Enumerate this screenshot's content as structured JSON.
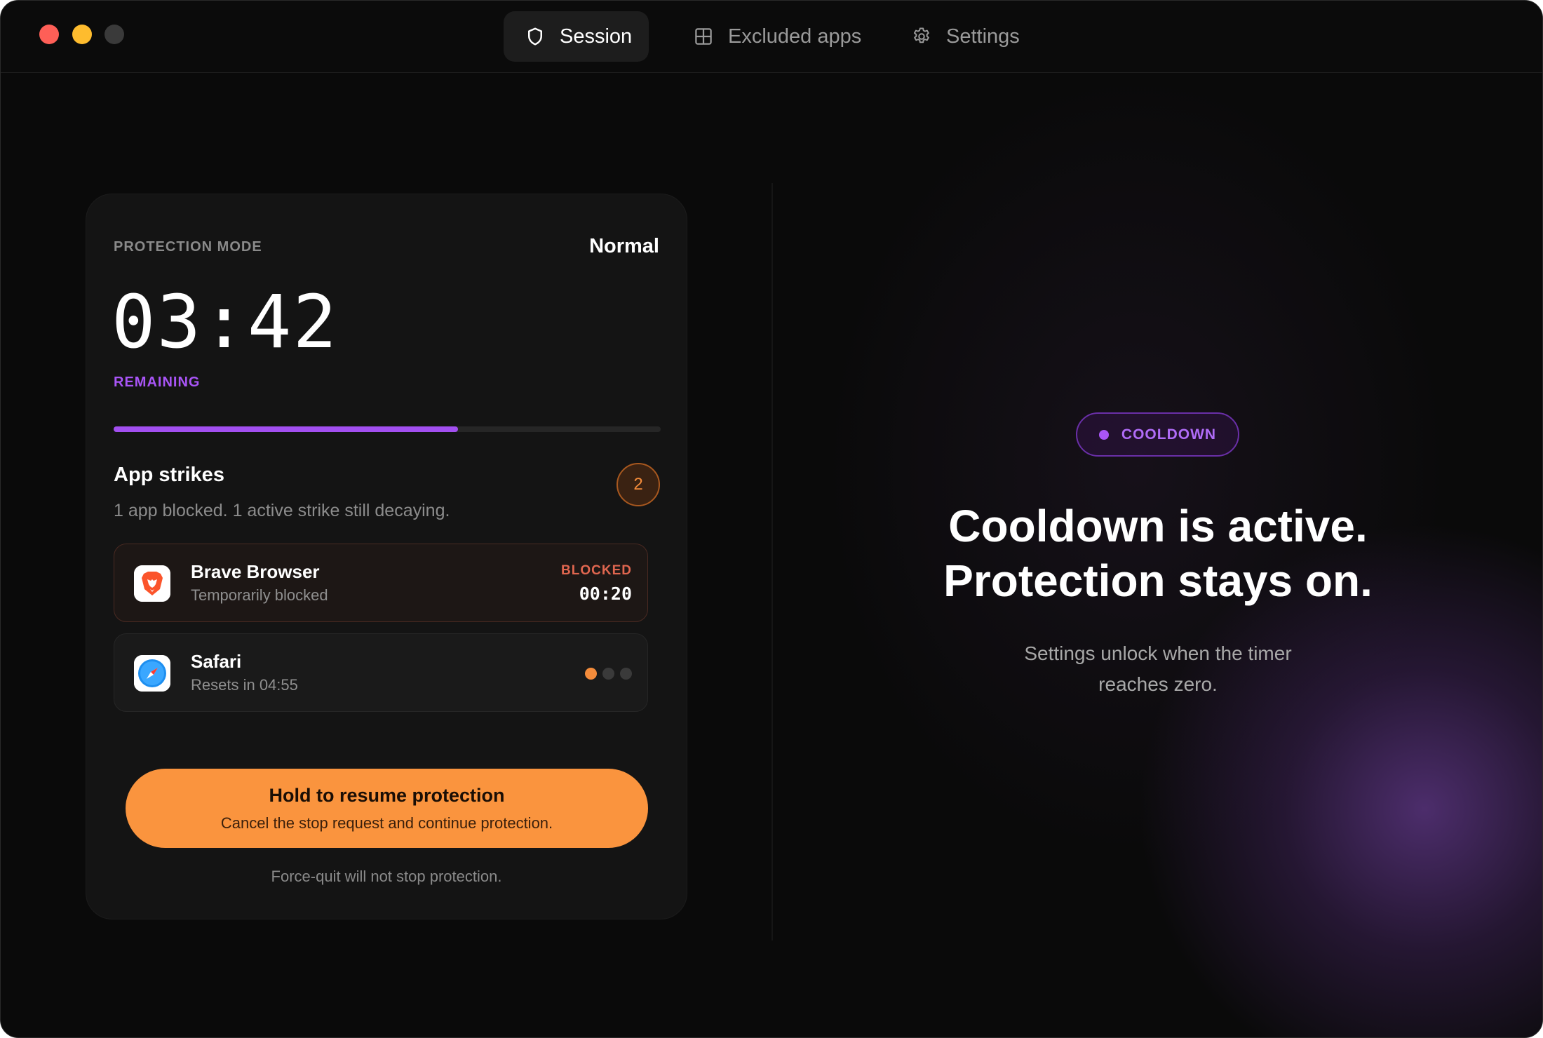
{
  "tabs": [
    {
      "label": "Session",
      "icon": "shield-icon",
      "active": true
    },
    {
      "label": "Excluded apps",
      "icon": "grid-icon",
      "active": false
    },
    {
      "label": "Settings",
      "icon": "gear-icon",
      "active": false
    }
  ],
  "session": {
    "mode_label": "PROTECTION MODE",
    "mode_value": "Normal",
    "timer": "03:42",
    "remaining_label": "REMAINING",
    "progress_fraction": 0.63
  },
  "strikes": {
    "title": "App strikes",
    "count": "2",
    "summary": "1 app blocked. 1 active strike still decaying."
  },
  "apps": [
    {
      "name": "Brave Browser",
      "status": "Temporarily blocked",
      "badge": "BLOCKED",
      "time": "00:20",
      "icon": "brave-lion-icon"
    },
    {
      "name": "Safari",
      "status": "Resets in 04:55",
      "strikes_active": 1,
      "strikes_total": 3,
      "icon": "safari-compass-icon"
    }
  ],
  "hold_button": {
    "title": "Hold to resume protection",
    "subtitle": "Cancel the stop request and continue protection."
  },
  "footnote": "Force-quit will not stop protection.",
  "cooldown": {
    "badge": "COOLDOWN",
    "headline_line1": "Cooldown is active.",
    "headline_line2": "Protection stays on.",
    "subtext_line1": "Settings unlock when the timer",
    "subtext_line2": "reaches zero."
  },
  "colors": {
    "accent_purple": "#a955f7",
    "accent_orange": "#fa943e",
    "blocked_red": "#e0664f",
    "window_close": "#fe5f57",
    "window_minimize": "#febc2e"
  }
}
